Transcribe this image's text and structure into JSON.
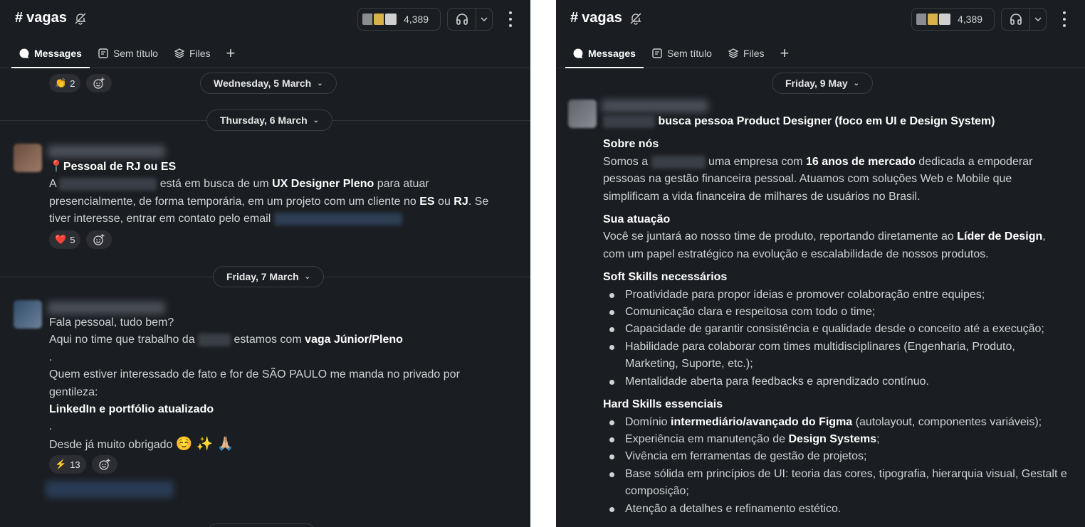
{
  "channel": {
    "hash": "#",
    "name": "vagas",
    "member_count": "4,389"
  },
  "tabs": {
    "messages": "Messages",
    "untitled": "Sem título",
    "files": "Files",
    "add": "+"
  },
  "left": {
    "reaction_top": {
      "emoji": "👏",
      "count": "2"
    },
    "date1": "Wednesday, 5 March",
    "date2": "Thursday, 6 March",
    "msg1": {
      "pin": "📍",
      "title": "Pessoal de RJ ou ES",
      "p_a": "A",
      "p_b": "está em busca de um",
      "p_b_bold": "UX Designer Pleno",
      "p_c": "para atuar",
      "line2": "presencialmente, de forma temporária, em um projeto com um cliente no",
      "es": "ES",
      "ou": "ou",
      "rj": "RJ",
      "se": ". Se",
      "line3": "tiver interesse, entrar em contato pelo email",
      "reaction": {
        "emoji": "❤️",
        "count": "5"
      }
    },
    "date3": "Friday, 7 March",
    "msg2": {
      "l1": "Fala pessoal, tudo bem?",
      "l2a": "Aqui no time que trabalho da",
      "l2b": "estamos com",
      "l2bold": "vaga Júnior/Pleno",
      "dot1": ".",
      "l3": "Quem estiver interessado de fato e for de SÃO PAULO me manda no privado por",
      "l4": "gentileza:",
      "l5": "LinkedIn e portfólio atualizado",
      "dot2": ".",
      "l6": "Desde já muito obrigado",
      "emojis": "☺️ ✨ 🙏🏼",
      "reaction": {
        "emoji": "⚡",
        "count": "13"
      }
    }
  },
  "right": {
    "date": "Friday, 9 May",
    "title": "busca pessoa Product Designer (foco em UI e Design System)",
    "sobre_h": "Sobre nós",
    "sobre_1a": "Somos a",
    "sobre_1b": "uma empresa com",
    "sobre_1bold": "16 anos de mercado",
    "sobre_1c": "dedicada a empoderar",
    "sobre_2": "pessoas na gestão financeira pessoal. Atuamos com soluções Web e Mobile que",
    "sobre_3": "simplificam a vida financeira de milhares de usuários no Brasil.",
    "atu_h": "Sua atuação",
    "atu_1a": "Você se juntará ao nosso time de produto, reportando diretamente ao",
    "atu_1bold": "Líder de Design",
    "atu_1c": ",",
    "atu_2": "com um papel estratégico na evolução e escalabilidade de nossos produtos.",
    "soft_h": "Soft Skills necessários",
    "soft": [
      "Proatividade para propor ideias e promover colaboração entre equipes;",
      "Comunicação clara e respeitosa com todo o time;",
      "Capacidade de garantir consistência e qualidade desde o conceito até a execução;",
      "Habilidade para colaborar com times multidisciplinares (Engenharia, Produto,",
      "Marketing, Suporte, etc.);",
      "Mentalidade aberta para feedbacks e aprendizado contínuo."
    ],
    "hard_h": "Hard Skills essenciais",
    "hard1a": "Domínio",
    "hard1bold": "intermediário/avançado do Figma",
    "hard1c": "(autolayout, componentes variáveis);",
    "hard2a": "Experiência em manutenção de",
    "hard2bold": "Design Systems",
    "hard2c": ";",
    "hard3": "Vivência em ferramentas de gestão de projetos;",
    "hard4": "Base sólida em princípios de UI: teoria das cores, tipografia, hierarquia visual, Gestalt e",
    "hard4b": "composição;",
    "hard5": "Atenção a detalhes e refinamento estético."
  }
}
